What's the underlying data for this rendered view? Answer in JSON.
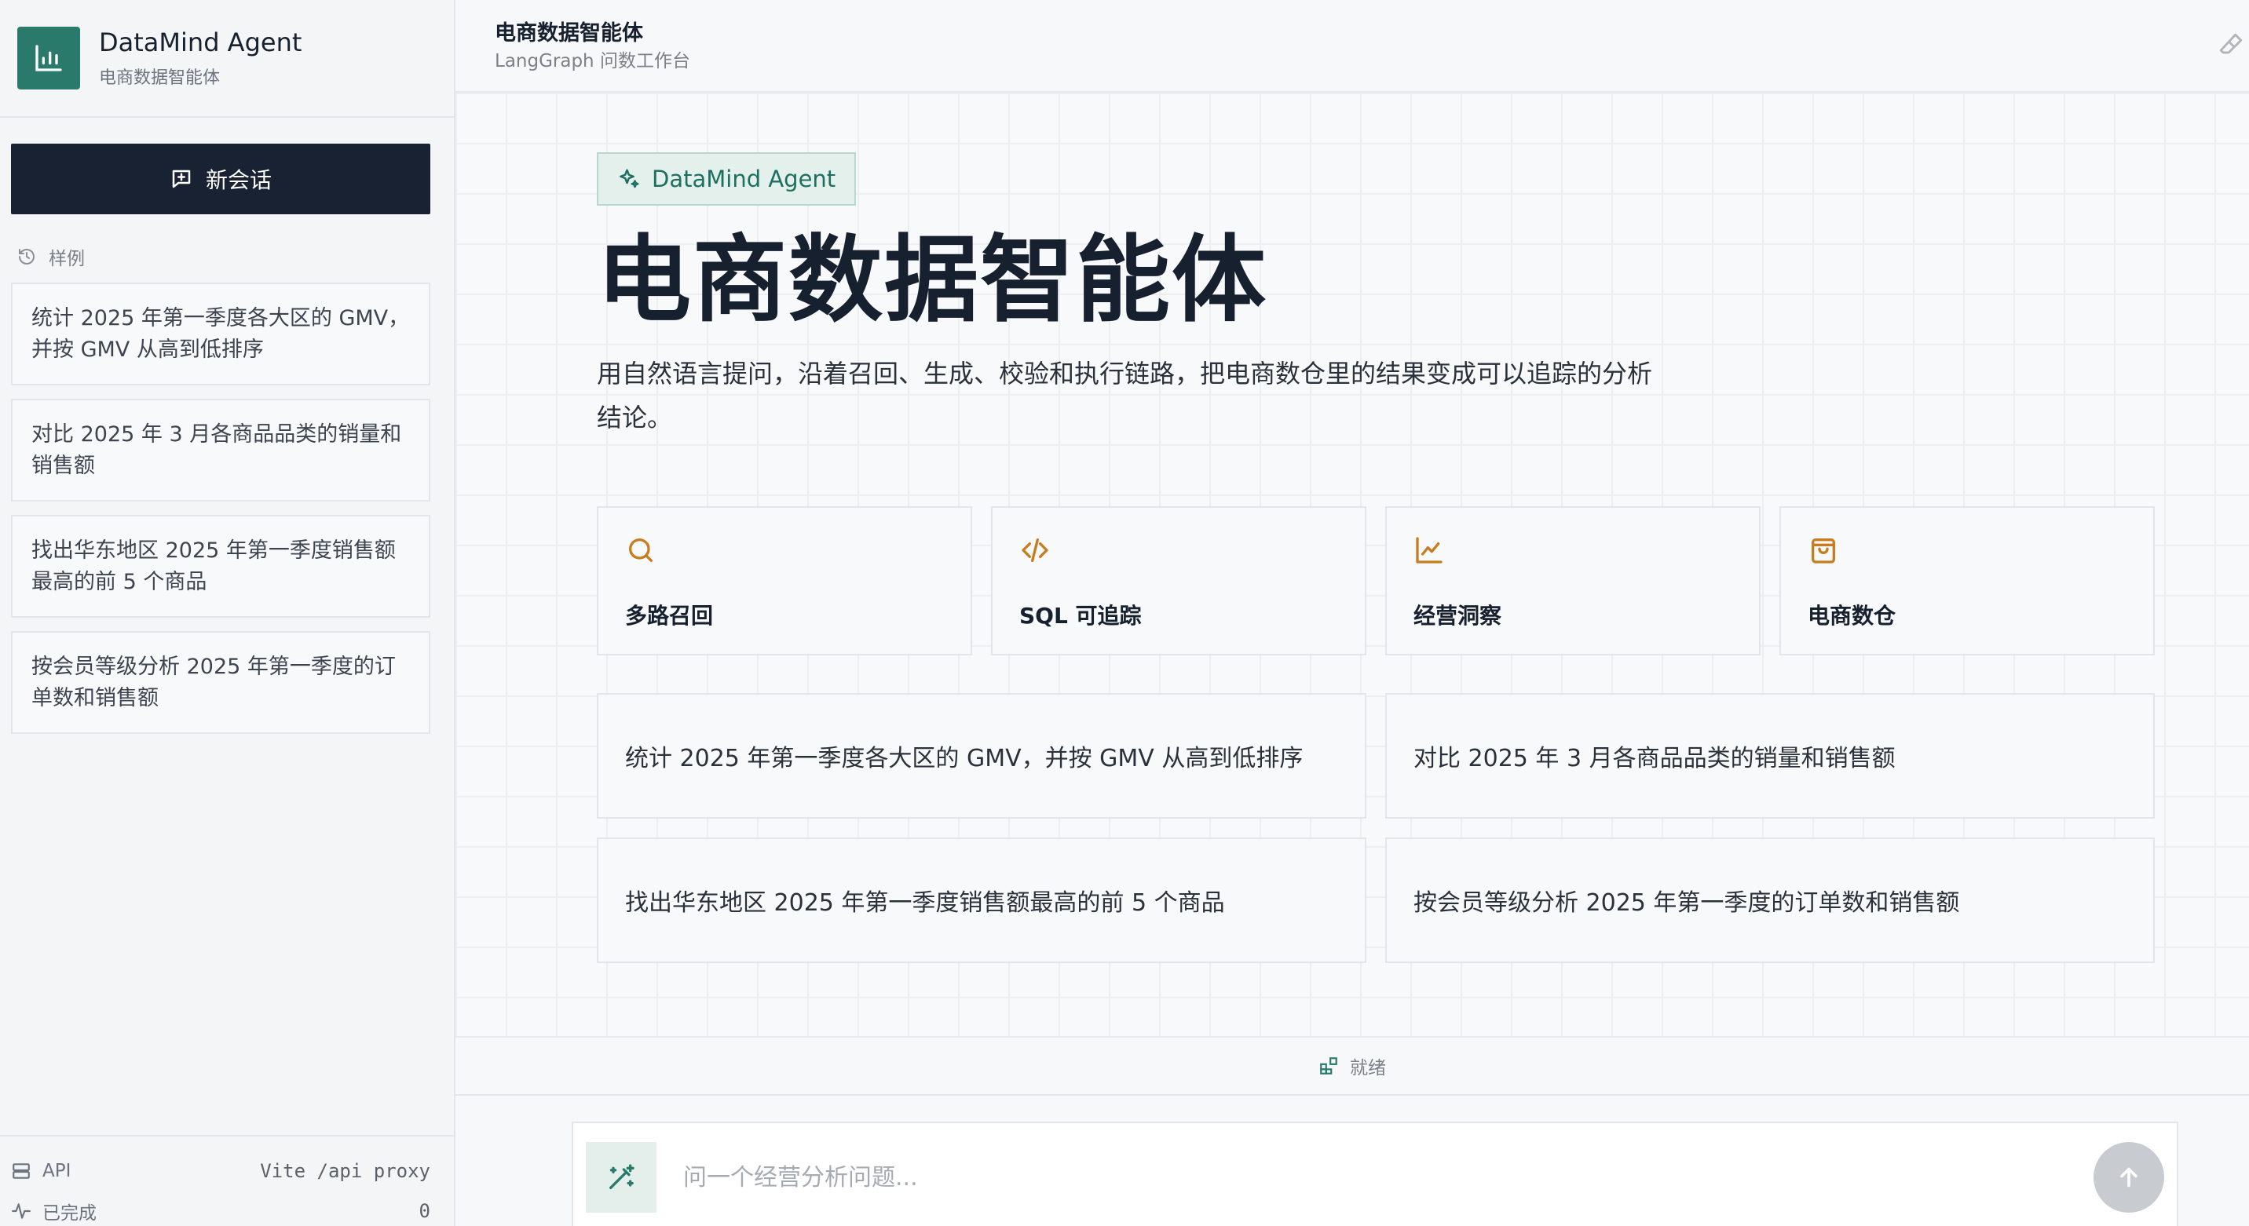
{
  "brand": {
    "title": "DataMind Agent",
    "subtitle": "电商数据智能体"
  },
  "sidebar": {
    "new_chat_label": "新会话",
    "examples_header": "样例",
    "examples": [
      "统计 2025 年第一季度各大区的 GMV，并按 GMV 从高到低排序",
      "对比 2025 年 3 月各商品品类的销量和销售额",
      "找出华东地区 2025 年第一季度销售额最高的前 5 个商品",
      "按会员等级分析 2025 年第一季度的订单数和销售额"
    ],
    "footer": {
      "api_label": "API",
      "api_value": "Vite /api proxy",
      "done_label": "已完成",
      "done_value": "0"
    }
  },
  "topbar": {
    "title": "电商数据智能体",
    "subtitle": "LangGraph 问数工作台"
  },
  "main": {
    "badge": "DataMind Agent",
    "hero_title": "电商数据智能体",
    "description": "用自然语言提问，沿着召回、生成、校验和执行链路，把电商数仓里的结果变成可以追踪的分析结论。",
    "features": [
      {
        "label": "多路召回",
        "icon": "search-icon"
      },
      {
        "label": "SQL 可追踪",
        "icon": "code-icon"
      },
      {
        "label": "经营洞察",
        "icon": "line-chart-icon"
      },
      {
        "label": "电商数仓",
        "icon": "shopping-bag-icon"
      }
    ],
    "prompts": [
      "统计 2025 年第一季度各大区的 GMV，并按 GMV 从高到低排序",
      "对比 2025 年 3 月各商品品类的销量和销售额",
      "找出华东地区 2025 年第一季度销售额最高的前 5 个商品",
      "按会员等级分析 2025 年第一季度的订单数和销售额"
    ]
  },
  "status": {
    "text": "就绪"
  },
  "composer": {
    "placeholder": "问一个经营分析问题..."
  },
  "colors": {
    "accent": "#2a7a6c",
    "primary_dark": "#182233",
    "icon_orange": "#c77d1f"
  }
}
